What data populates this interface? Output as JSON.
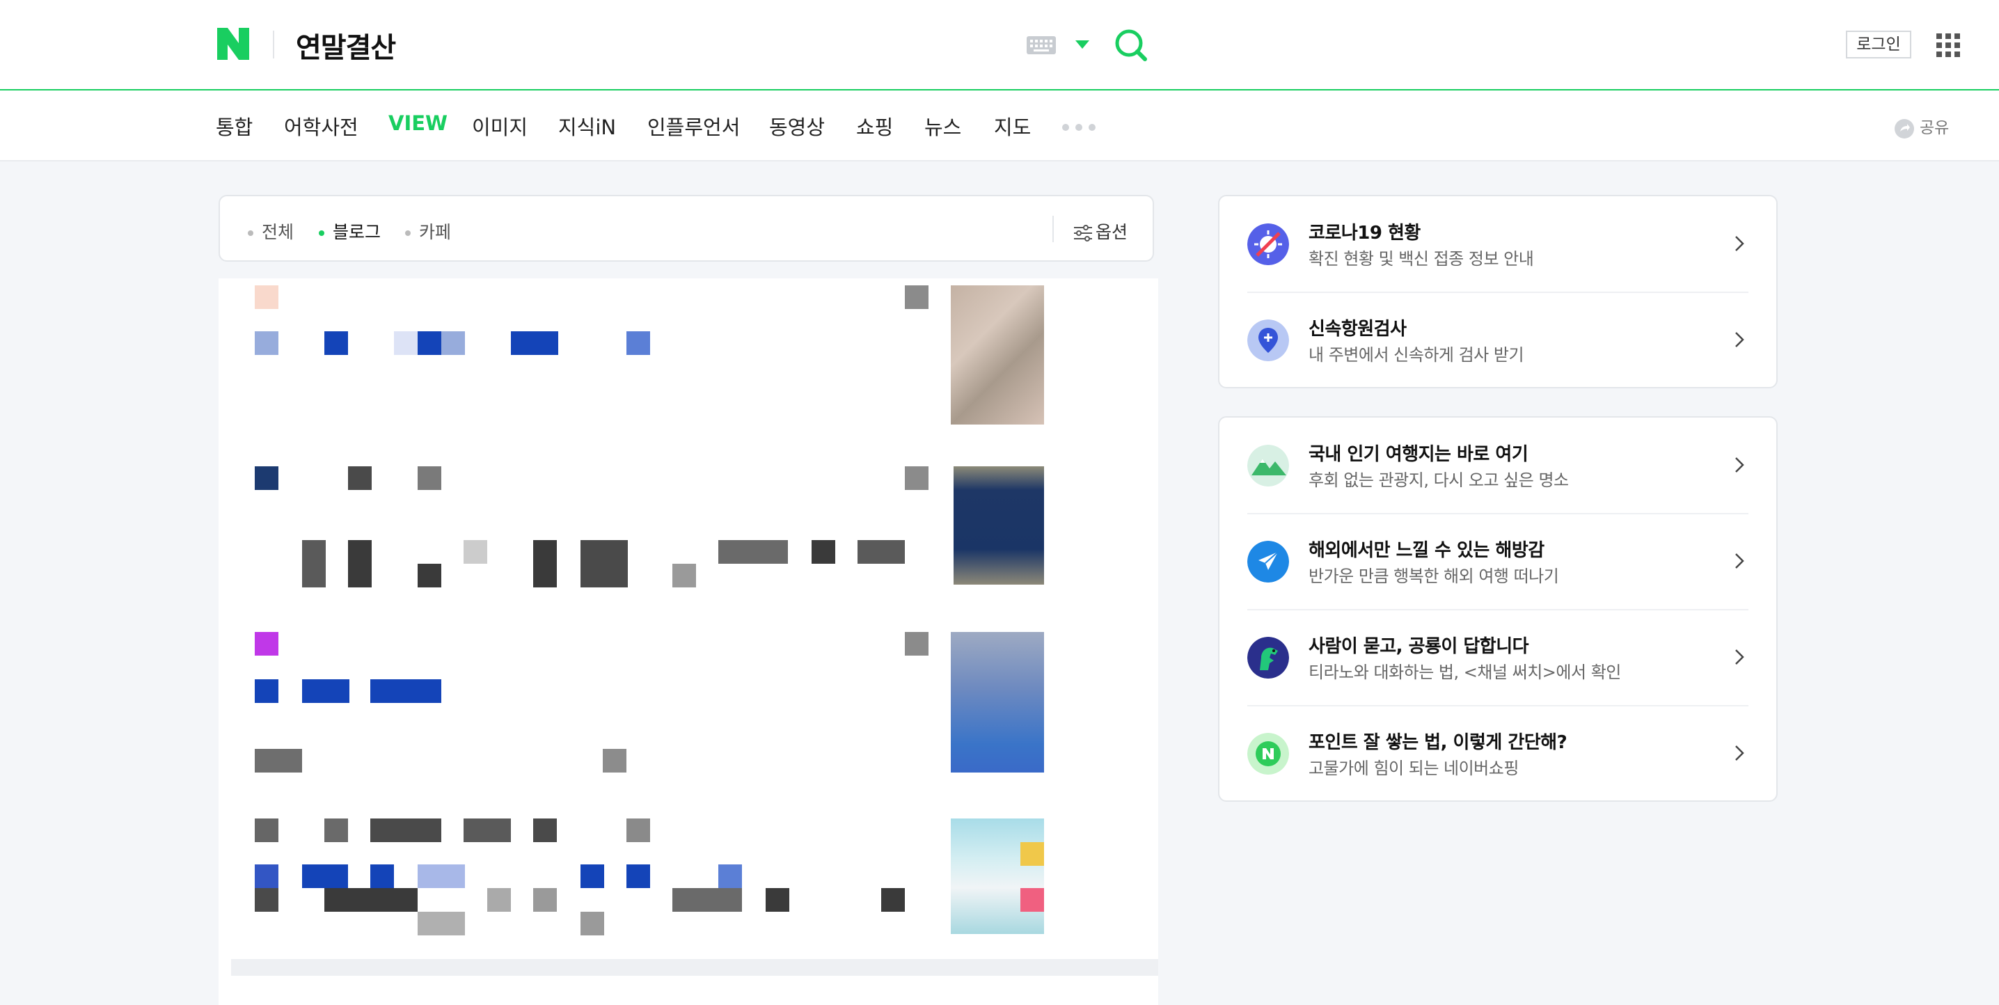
{
  "header": {
    "logo": "N",
    "query": "연말결산",
    "login_label": "로그인",
    "icons": [
      "keyboard-icon",
      "dropdown-icon",
      "search-icon",
      "apps-grid-icon"
    ],
    "brand_color": "#19ce60"
  },
  "nav": {
    "tabs": [
      {
        "label": "통합",
        "active": false
      },
      {
        "label": "어학사전",
        "active": false
      },
      {
        "label": "VIEW",
        "active": true
      },
      {
        "label": "이미지",
        "active": false
      },
      {
        "label": "지식iN",
        "active": false
      },
      {
        "label": "인플루언서",
        "active": false
      },
      {
        "label": "동영상",
        "active": false
      },
      {
        "label": "쇼핑",
        "active": false
      },
      {
        "label": "뉴스",
        "active": false
      },
      {
        "label": "지도",
        "active": false
      }
    ],
    "share_label": "공유"
  },
  "filters": {
    "items": [
      {
        "label": "전체",
        "active": false
      },
      {
        "label": "블로그",
        "active": true
      },
      {
        "label": "카페",
        "active": false
      }
    ],
    "options_label": "옵션"
  },
  "side": {
    "card1": [
      {
        "title": "코로나19 현황",
        "subtitle": "확진 현황 및 백신 접종 정보 안내",
        "icon": "covid-icon"
      },
      {
        "title": "신속항원검사",
        "subtitle": "내 주변에서 신속하게 검사 받기",
        "icon": "location-pin-icon"
      }
    ],
    "card2": [
      {
        "title": "국내 인기 여행지는 바로 여기",
        "subtitle": "후회 없는 관광지, 다시 오고 싶은 명소",
        "icon": "mountain-icon"
      },
      {
        "title": "해외에서만 느낄 수 있는 해방감",
        "subtitle": "반가운 만큼 행복한 해외 여행 떠나기",
        "icon": "airplane-icon"
      },
      {
        "title": "사람이 묻고, 공룡이 답합니다",
        "subtitle": "티라노와 대화하는 법, <채널 써치>에서 확인",
        "icon": "dinosaur-icon"
      },
      {
        "title": "포인트 잘 쌓는 법, 이렇게 간단해?",
        "subtitle": "고물가에 힘이 되는 네이버쇼핑",
        "icon": "naver-pay-icon"
      }
    ]
  }
}
